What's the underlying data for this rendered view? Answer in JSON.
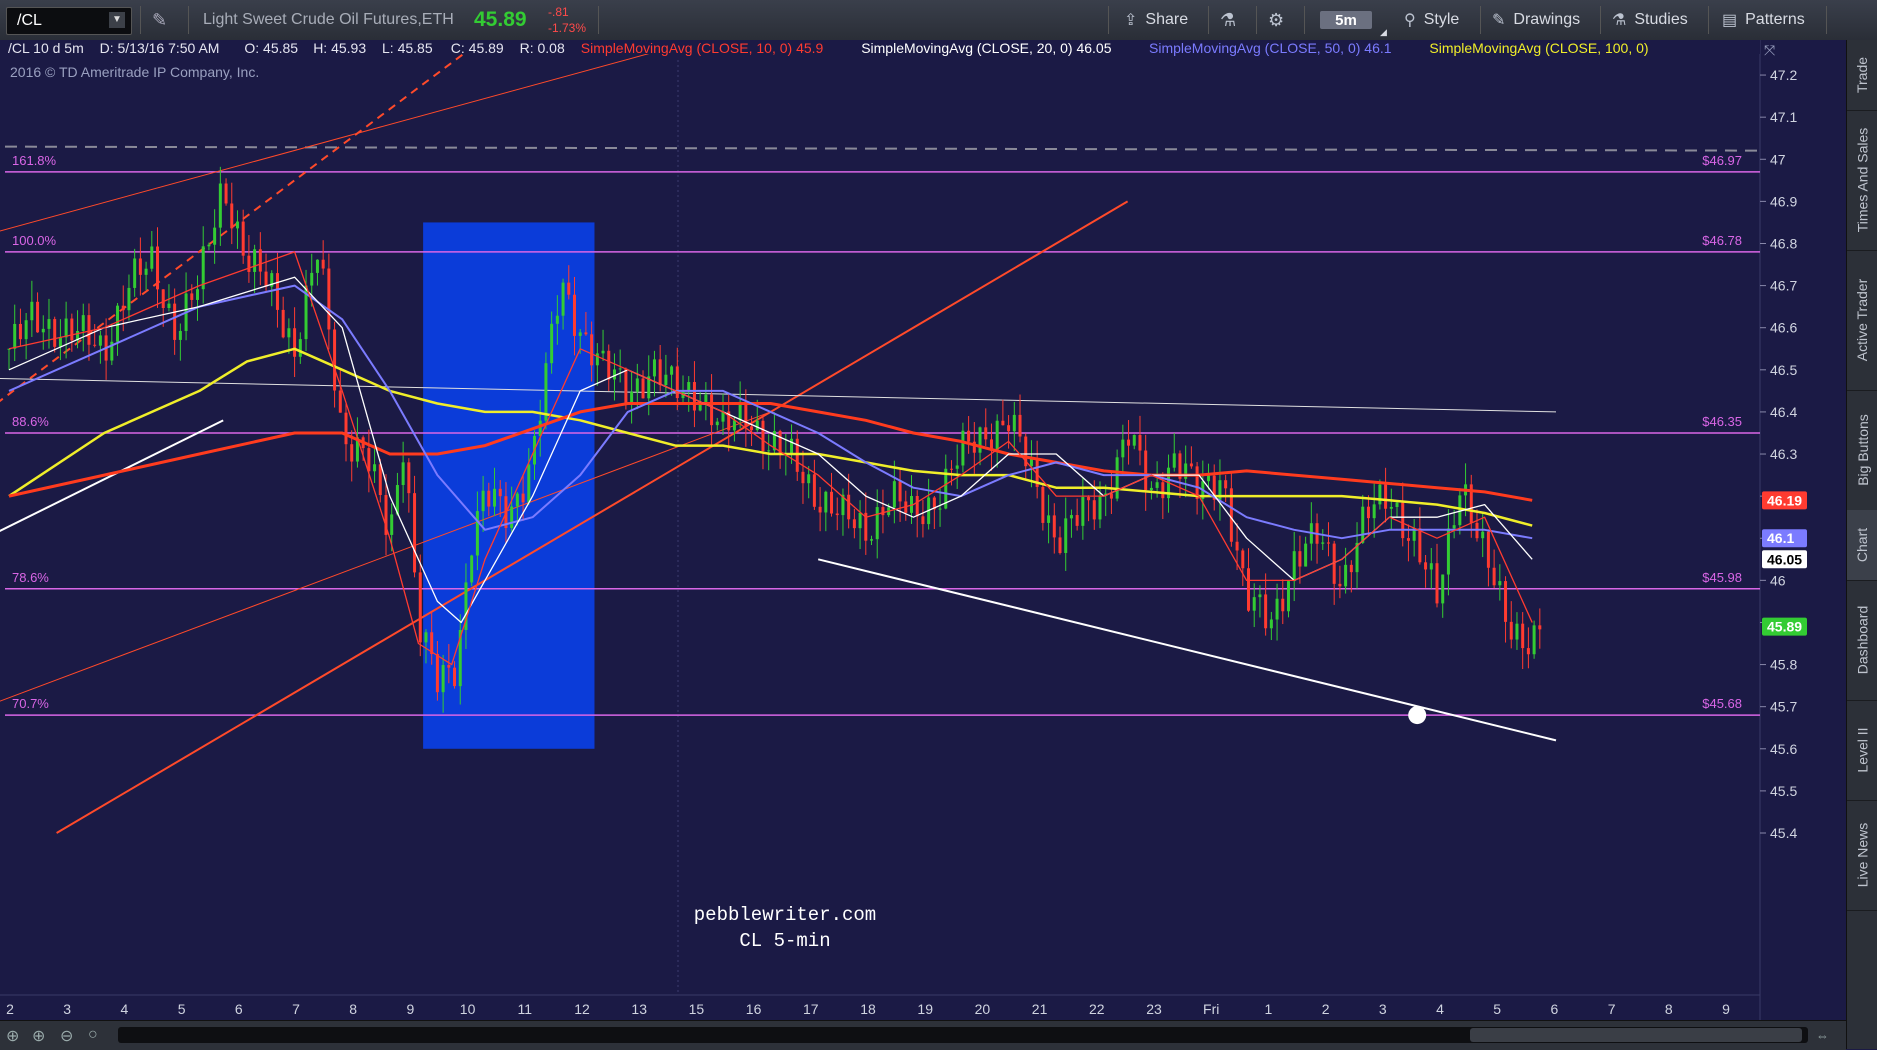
{
  "toolbar": {
    "symbol": "/CL",
    "instrument_name": "Light Sweet Crude Oil Futures,ETH",
    "last_price": "45.89",
    "change": "-.81",
    "change_pct": "-1.73%",
    "share_label": "Share",
    "timeframe_label": "5m",
    "style_label": "Style",
    "drawings_label": "Drawings",
    "studies_label": "Studies",
    "patterns_label": "Patterns"
  },
  "side_tabs": [
    "Trade",
    "Times And Sales",
    "Active Trader",
    "Big Buttons",
    "Chart",
    "Dashboard",
    "Level II",
    "Live News"
  ],
  "colors": {
    "background": "#1b1a45",
    "sma10": "#ff3b30",
    "sma20": "#ffffff",
    "sma50": "#7b7bff",
    "sma100": "#f0ee2a",
    "fib_line": "#d966e6",
    "trendline": "#ff4a2a",
    "highlight": "#0a3fe6",
    "price_up": "#33cc33",
    "price_down": "#ff3b30"
  },
  "chart_data": {
    "type": "candlestick",
    "header": {
      "symbol_period": "/CL 10 d 5m",
      "date_time": "D: 5/13/16 7:50 AM",
      "open": "O: 45.85",
      "high": "H: 45.93",
      "low": "L: 45.85",
      "close": "C: 45.89",
      "range": "R: 0.08"
    },
    "studies": [
      {
        "label": "SimpleMovingAvg (CLOSE, 10, 0)",
        "value": "45.9",
        "color": "#ff3b30"
      },
      {
        "label": "SimpleMovingAvg (CLOSE, 20, 0)",
        "value": "46.05",
        "color": "#ffffff"
      },
      {
        "label": "SimpleMovingAvg (CLOSE, 50, 0)",
        "value": "46.1",
        "color": "#7b7bff"
      },
      {
        "label": "SimpleMovingAvg (CLOSE, 100, 0)",
        "value": "",
        "color": "#f0ee2a"
      }
    ],
    "copyright": "2016 © TD Ameritrade IP Company, Inc.",
    "y_ticks": [
      "47.2",
      "47.1",
      "47",
      "46.9",
      "46.8",
      "46.7",
      "46.6",
      "46.5",
      "46.4",
      "46.3",
      "46.2",
      "46.1",
      "46",
      "45.9",
      "45.8",
      "45.7",
      "45.6",
      "45.5",
      "45.4"
    ],
    "x_ticks": [
      "2",
      "3",
      "4",
      "5",
      "6",
      "7",
      "8",
      "9",
      "10",
      "11",
      "12",
      "13",
      "15",
      "16",
      "17",
      "18",
      "19",
      "20",
      "21",
      "22",
      "23",
      "Fri",
      "1",
      "2",
      "3",
      "4",
      "5",
      "6",
      "7",
      "8",
      "9"
    ],
    "ylim": [
      45.4,
      47.25
    ],
    "fib_levels": [
      {
        "label": "161.8%",
        "price": 46.97,
        "value_label": "$46.97"
      },
      {
        "label": "100.0%",
        "price": 46.78,
        "value_label": "$46.78"
      },
      {
        "label": "88.6%",
        "price": 46.35,
        "value_label": "$46.35"
      },
      {
        "label": "78.6%",
        "price": 45.98,
        "value_label": "$45.98"
      },
      {
        "label": "70.7%",
        "price": 45.68,
        "value_label": "$45.68"
      }
    ],
    "price_tags": [
      {
        "value": "46.19",
        "price": 46.19,
        "color": "#ff3b30"
      },
      {
        "value": "46.1",
        "price": 46.1,
        "color": "#7b7bff"
      },
      {
        "value": "46.05",
        "price": 46.05,
        "color": "#ffffff"
      },
      {
        "value": "45.89",
        "price": 45.89,
        "color": "#33cc33"
      }
    ],
    "highlight_zone": {
      "x_from": 8.7,
      "x_to": 12.3,
      "y_from": 45.6,
      "y_to": 46.85
    },
    "price_path": [
      [
        0,
        46.55
      ],
      [
        0.5,
        46.62
      ],
      [
        1,
        46.6
      ],
      [
        1.5,
        46.58
      ],
      [
        2,
        46.55
      ],
      [
        2.5,
        46.7
      ],
      [
        3,
        46.75
      ],
      [
        3.5,
        46.6
      ],
      [
        4,
        46.7
      ],
      [
        4.5,
        46.95
      ],
      [
        5,
        46.75
      ],
      [
        5.5,
        46.7
      ],
      [
        6,
        46.55
      ],
      [
        6.5,
        46.78
      ],
      [
        7,
        46.35
      ],
      [
        7.5,
        46.3
      ],
      [
        8,
        46.1
      ],
      [
        8.3,
        46.35
      ],
      [
        8.6,
        45.9
      ],
      [
        9,
        45.75
      ],
      [
        9.4,
        45.8
      ],
      [
        9.7,
        46.1
      ],
      [
        10,
        46.2
      ],
      [
        10.5,
        46.15
      ],
      [
        11,
        46.3
      ],
      [
        11.3,
        46.5
      ],
      [
        11.6,
        46.7
      ],
      [
        12,
        46.6
      ],
      [
        12.5,
        46.5
      ],
      [
        13,
        46.45
      ],
      [
        13.5,
        46.5
      ],
      [
        14,
        46.45
      ],
      [
        14.5,
        46.45
      ],
      [
        15,
        46.35
      ],
      [
        15.5,
        46.4
      ],
      [
        16,
        46.32
      ],
      [
        16.5,
        46.28
      ],
      [
        17,
        46.2
      ],
      [
        17.5,
        46.15
      ],
      [
        18,
        46.12
      ],
      [
        18.5,
        46.2
      ],
      [
        19,
        46.15
      ],
      [
        19.5,
        46.2
      ],
      [
        20,
        46.3
      ],
      [
        20.5,
        46.35
      ],
      [
        21,
        46.38
      ],
      [
        21.5,
        46.25
      ],
      [
        22,
        46.1
      ],
      [
        22.5,
        46.15
      ],
      [
        23,
        46.2
      ],
      [
        23.5,
        46.35
      ],
      [
        24,
        46.2
      ],
      [
        24.5,
        46.3
      ],
      [
        25,
        46.2
      ],
      [
        25.5,
        46.25
      ],
      [
        26,
        45.95
      ],
      [
        26.5,
        45.9
      ],
      [
        27,
        46.05
      ],
      [
        27.5,
        46.1
      ],
      [
        28,
        46.0
      ],
      [
        28.5,
        46.15
      ],
      [
        29,
        46.2
      ],
      [
        29.5,
        46.1
      ],
      [
        30,
        45.95
      ],
      [
        30.5,
        46.25
      ],
      [
        31,
        46.05
      ],
      [
        31.5,
        45.9
      ],
      [
        32,
        45.85
      ],
      [
        32.2,
        45.89
      ]
    ],
    "sma10": [
      [
        0,
        46.55
      ],
      [
        2,
        46.6
      ],
      [
        4,
        46.7
      ],
      [
        6,
        46.78
      ],
      [
        7,
        46.45
      ],
      [
        8,
        46.1
      ],
      [
        8.6,
        45.85
      ],
      [
        9.3,
        45.8
      ],
      [
        10,
        46.05
      ],
      [
        11,
        46.3
      ],
      [
        12,
        46.55
      ],
      [
        13,
        46.5
      ],
      [
        14,
        46.45
      ],
      [
        15,
        46.4
      ],
      [
        16,
        46.32
      ],
      [
        17,
        46.25
      ],
      [
        18,
        46.15
      ],
      [
        19,
        46.18
      ],
      [
        20,
        46.25
      ],
      [
        21,
        46.33
      ],
      [
        22,
        46.2
      ],
      [
        23,
        46.2
      ],
      [
        24,
        46.25
      ],
      [
        25,
        46.2
      ],
      [
        26,
        46.0
      ],
      [
        27,
        46.0
      ],
      [
        28,
        46.05
      ],
      [
        29,
        46.15
      ],
      [
        30,
        46.1
      ],
      [
        31,
        46.15
      ],
      [
        32,
        45.9
      ]
    ],
    "sma20": [
      [
        0,
        46.5
      ],
      [
        2,
        46.6
      ],
      [
        4,
        46.65
      ],
      [
        6,
        46.72
      ],
      [
        7,
        46.6
      ],
      [
        8,
        46.2
      ],
      [
        9,
        45.95
      ],
      [
        9.5,
        45.9
      ],
      [
        10,
        46.0
      ],
      [
        11,
        46.2
      ],
      [
        12,
        46.45
      ],
      [
        13,
        46.5
      ],
      [
        14,
        46.45
      ],
      [
        15,
        46.4
      ],
      [
        16,
        46.35
      ],
      [
        17,
        46.3
      ],
      [
        18,
        46.2
      ],
      [
        19,
        46.15
      ],
      [
        20,
        46.2
      ],
      [
        21,
        46.3
      ],
      [
        22,
        46.3
      ],
      [
        23,
        46.2
      ],
      [
        24,
        46.25
      ],
      [
        25,
        46.25
      ],
      [
        26,
        46.1
      ],
      [
        27,
        46.0
      ],
      [
        28,
        46.05
      ],
      [
        29,
        46.15
      ],
      [
        30,
        46.15
      ],
      [
        31,
        46.18
      ],
      [
        32,
        46.05
      ]
    ],
    "sma50": [
      [
        0,
        46.45
      ],
      [
        2,
        46.55
      ],
      [
        4,
        46.65
      ],
      [
        6,
        46.7
      ],
      [
        7,
        46.62
      ],
      [
        8,
        46.45
      ],
      [
        9,
        46.25
      ],
      [
        10,
        46.12
      ],
      [
        11,
        46.15
      ],
      [
        12,
        46.25
      ],
      [
        13,
        46.4
      ],
      [
        14,
        46.45
      ],
      [
        15,
        46.45
      ],
      [
        16,
        46.4
      ],
      [
        17,
        46.35
      ],
      [
        18,
        46.28
      ],
      [
        19,
        46.22
      ],
      [
        20,
        46.2
      ],
      [
        21,
        46.25
      ],
      [
        22,
        46.28
      ],
      [
        23,
        46.25
      ],
      [
        24,
        46.25
      ],
      [
        25,
        46.22
      ],
      [
        26,
        46.15
      ],
      [
        27,
        46.12
      ],
      [
        28,
        46.1
      ],
      [
        29,
        46.12
      ],
      [
        30,
        46.12
      ],
      [
        31,
        46.12
      ],
      [
        32,
        46.1
      ]
    ],
    "sma100": [
      [
        0,
        46.2
      ],
      [
        2,
        46.35
      ],
      [
        4,
        46.45
      ],
      [
        5,
        46.52
      ],
      [
        6,
        46.55
      ],
      [
        7,
        46.5
      ],
      [
        8,
        46.45
      ],
      [
        9,
        46.42
      ],
      [
        10,
        46.4
      ],
      [
        11,
        46.4
      ],
      [
        12,
        46.38
      ],
      [
        13,
        46.35
      ],
      [
        14,
        46.32
      ],
      [
        15,
        46.32
      ],
      [
        16,
        46.3
      ],
      [
        17,
        46.3
      ],
      [
        18,
        46.28
      ],
      [
        19,
        46.26
      ],
      [
        20,
        46.25
      ],
      [
        21,
        46.25
      ],
      [
        22,
        46.22
      ],
      [
        23,
        46.22
      ],
      [
        24,
        46.21
      ],
      [
        25,
        46.2
      ],
      [
        26,
        46.2
      ],
      [
        27,
        46.2
      ],
      [
        28,
        46.2
      ],
      [
        29,
        46.19
      ],
      [
        30,
        46.18
      ],
      [
        31,
        46.16
      ],
      [
        32,
        46.13
      ]
    ],
    "sma200": [
      [
        0,
        46.2
      ],
      [
        2,
        46.25
      ],
      [
        4,
        46.3
      ],
      [
        6,
        46.35
      ],
      [
        7,
        46.35
      ],
      [
        8,
        46.3
      ],
      [
        9,
        46.3
      ],
      [
        10,
        46.32
      ],
      [
        11,
        46.36
      ],
      [
        12,
        46.4
      ],
      [
        13,
        46.42
      ],
      [
        14,
        46.42
      ],
      [
        15,
        46.42
      ],
      [
        16,
        46.42
      ],
      [
        17,
        46.4
      ],
      [
        18,
        46.38
      ],
      [
        19,
        46.35
      ],
      [
        20,
        46.33
      ],
      [
        21,
        46.3
      ],
      [
        22,
        46.28
      ],
      [
        23,
        46.26
      ],
      [
        24,
        46.25
      ],
      [
        25,
        46.25
      ],
      [
        26,
        46.26
      ],
      [
        27,
        46.25
      ],
      [
        28,
        46.24
      ],
      [
        29,
        46.23
      ],
      [
        30,
        46.22
      ],
      [
        31,
        46.21
      ],
      [
        32,
        46.19
      ]
    ],
    "trendlines": [
      {
        "name": "upper-channel-thin",
        "from": [
          -0.5,
          46.82
        ],
        "to": [
          21.5,
          47.5
        ],
        "color": "#ff4a2a",
        "width": 1,
        "dash": ""
      },
      {
        "name": "upper-channel-dashed",
        "from": [
          -0.5,
          46.4
        ],
        "to": [
          12.5,
          47.5
        ],
        "color": "#ff4a2a",
        "width": 2,
        "dash": "8,6"
      },
      {
        "name": "mid-channel-thin",
        "from": [
          -0.5,
          45.7
        ],
        "to": [
          16,
          46.4
        ],
        "color": "#ff4a2a",
        "width": 1,
        "dash": ""
      },
      {
        "name": "lower-channel-bold",
        "from": [
          1,
          45.4
        ],
        "to": [
          23.5,
          46.9
        ],
        "color": "#ff4a2a",
        "width": 2,
        "dash": ""
      },
      {
        "name": "horizontal-white",
        "from": [
          -0.5,
          46.48
        ],
        "to": [
          32.5,
          46.4
        ],
        "color": "#e0e0e0",
        "width": 1,
        "dash": ""
      },
      {
        "name": "rising-white",
        "from": [
          -0.5,
          46.1
        ],
        "to": [
          4.5,
          46.38
        ],
        "color": "#ffffff",
        "width": 2,
        "dash": ""
      },
      {
        "name": "falling-white",
        "from": [
          17,
          46.05
        ],
        "to": [
          32.5,
          45.62
        ],
        "color": "#ffffff",
        "width": 2,
        "dash": ""
      }
    ],
    "dashed_resistance": 47.03,
    "endpoint_marker": [
      29.5,
      45.68
    ],
    "watermark": [
      "pebblewriter.com",
      "CL 5-min"
    ]
  }
}
